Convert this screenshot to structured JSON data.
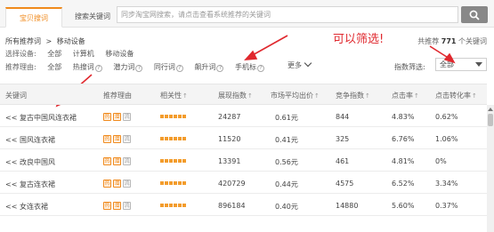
{
  "tabs": [
    {
      "label": "宝贝搜词",
      "active": true
    },
    {
      "label": "搜索关键词",
      "active": false
    }
  ],
  "search": {
    "placeholder": "同步淘宝网搜索，请点击查看系统推荐的关键词",
    "icon": "search-icon"
  },
  "breadcrumb": {
    "root": "所有推荐词",
    "sep": ">",
    "current": "移动设备"
  },
  "total": {
    "prefix": "共推荐",
    "count": "771",
    "suffix": "个关键词"
  },
  "filters": {
    "device": {
      "label": "选择设备:",
      "options": [
        "全部",
        "计算机",
        "移动设备"
      ],
      "selected": 0
    },
    "reason": {
      "label": "推荐理由:",
      "options": [
        "全部",
        "热搜词",
        "潜力词",
        "同行词",
        "飙升词",
        "手机标"
      ],
      "selected": 0,
      "more": "更多"
    },
    "index": {
      "label": "指数筛选:",
      "selected": "全部"
    }
  },
  "annotation": {
    "text": "可以筛选!",
    "color": "#e0282e"
  },
  "colors": {
    "accent": "#f08a1c",
    "relevance": "#f39c2c",
    "annotation": "#e0282e"
  },
  "table": {
    "columns": [
      "关键词",
      "推荐理由",
      "相关性",
      "展现指数",
      "市场平均出价",
      "竞争指数",
      "点击率",
      "点击转化率"
    ],
    "rows": [
      {
        "prefix": "<<",
        "keyword": "复古中国风连衣裙",
        "tags": [
          "热",
          "潜",
          "流"
        ],
        "relevance": 5,
        "impressions": "24287",
        "avg_bid": "0.61元",
        "competition": "844",
        "ctr": "4.83%",
        "cvr": "0.62%"
      },
      {
        "prefix": "<<",
        "keyword": "国风连衣裙",
        "tags": [
          "热",
          "潜",
          "流"
        ],
        "relevance": 5,
        "impressions": "11520",
        "avg_bid": "0.41元",
        "competition": "325",
        "ctr": "6.76%",
        "cvr": "1.06%"
      },
      {
        "prefix": "<<",
        "keyword": "改良中国风",
        "tags": [
          "热",
          "潜",
          "流"
        ],
        "relevance": 5,
        "impressions": "13391",
        "avg_bid": "0.56元",
        "competition": "461",
        "ctr": "4.81%",
        "cvr": "0%"
      },
      {
        "prefix": "<<",
        "keyword": "复古连衣裙",
        "tags": [
          "热",
          "潜",
          "流"
        ],
        "relevance": 5,
        "impressions": "420729",
        "avg_bid": "0.44元",
        "competition": "4575",
        "ctr": "6.52%",
        "cvr": "3.34%"
      },
      {
        "prefix": "<<",
        "keyword": "女连衣裙",
        "tags": [
          "热",
          "潜",
          "流"
        ],
        "relevance": 5,
        "impressions": "896184",
        "avg_bid": "0.40元",
        "competition": "14880",
        "ctr": "5.60%",
        "cvr": "0.37%"
      }
    ]
  }
}
